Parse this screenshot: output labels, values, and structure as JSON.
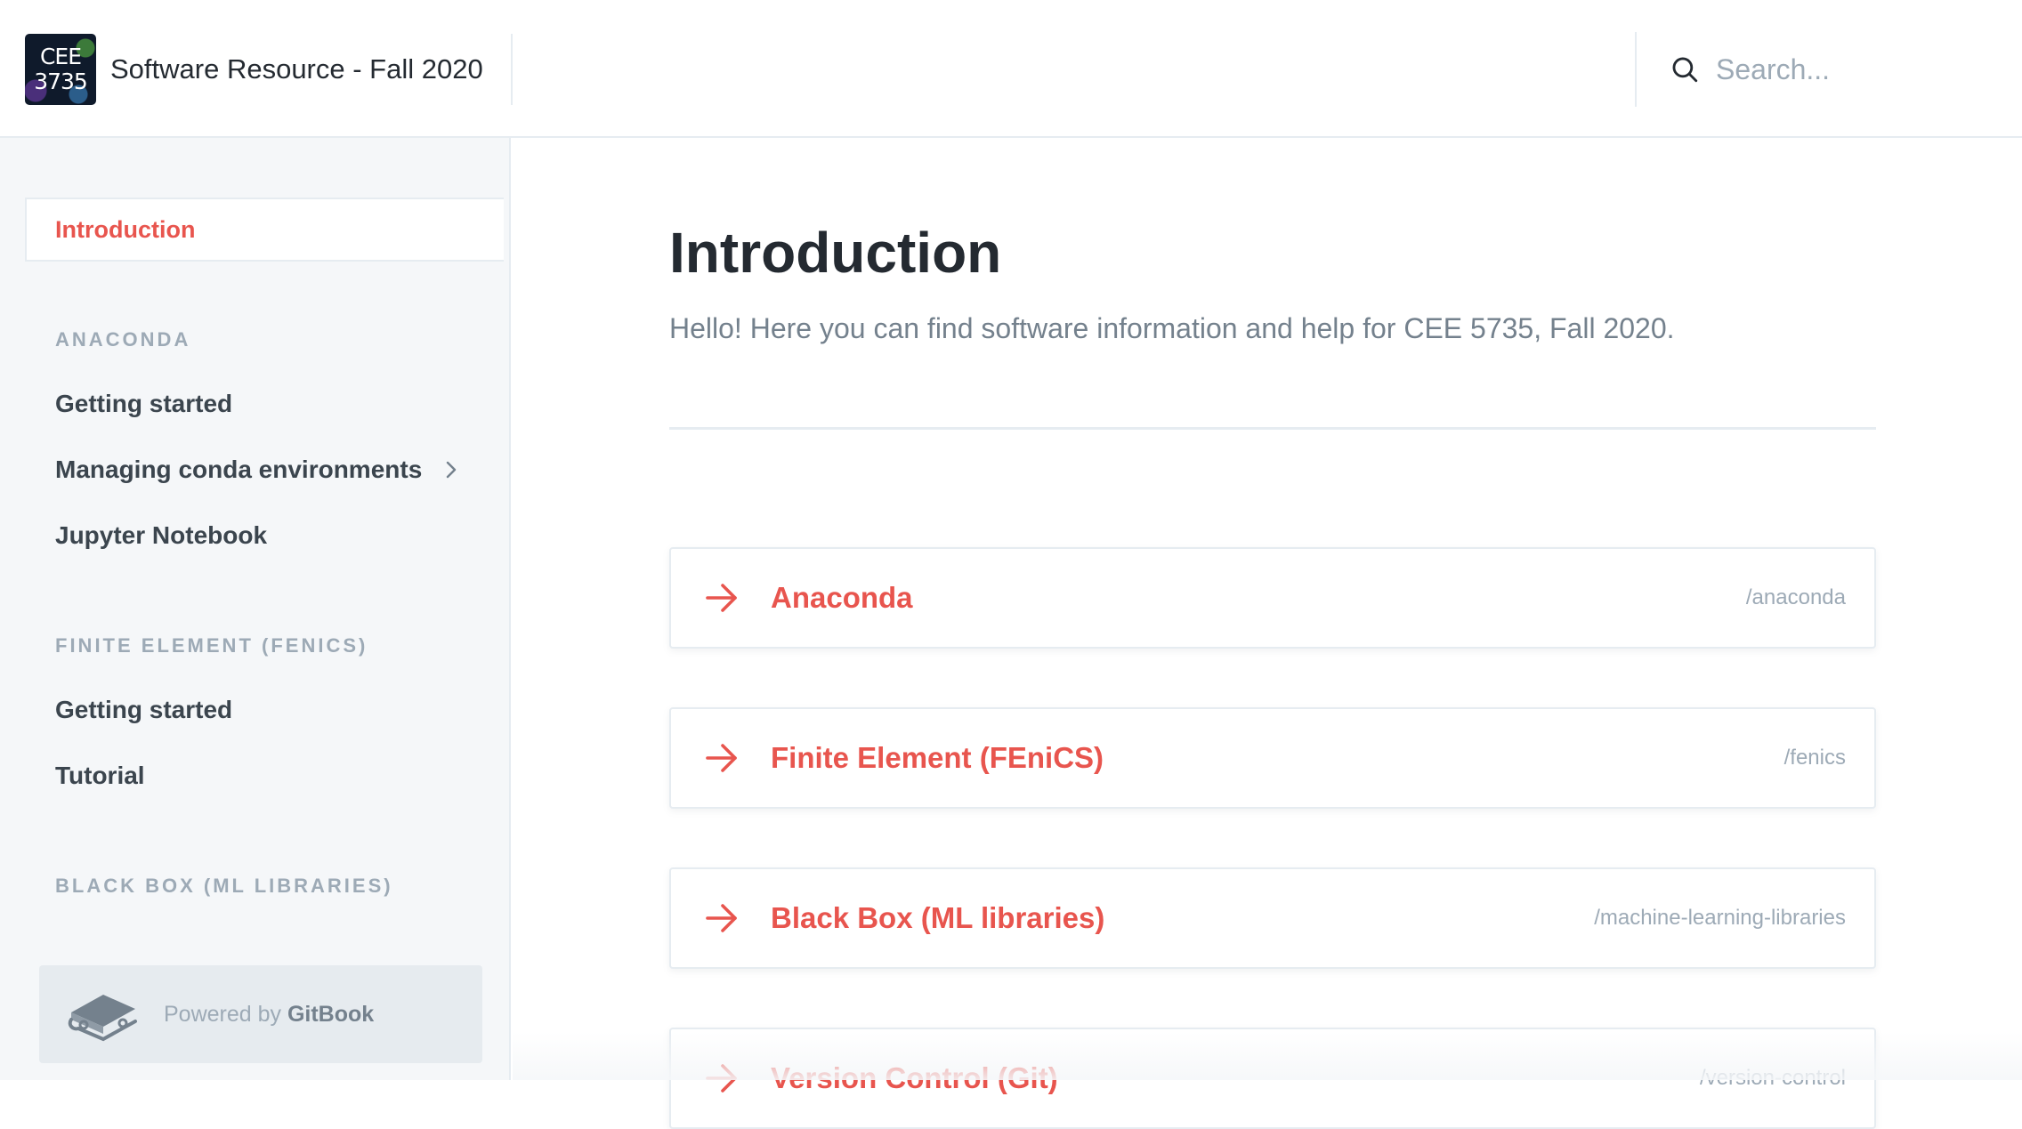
{
  "header": {
    "logo_line1": "CEE",
    "logo_line2": "3735",
    "title": "Software Resource - Fall 2020",
    "search_placeholder": "Search..."
  },
  "sidebar": {
    "active_item": "Introduction",
    "sections": [
      {
        "label": "ANACONDA",
        "items": [
          "Getting started",
          "Managing conda environments",
          "Jupyter Notebook"
        ]
      },
      {
        "label": "FINITE ELEMENT (FENICS)",
        "items": [
          "Getting started",
          "Tutorial"
        ]
      },
      {
        "label": "BLACK BOX (ML LIBRARIES)",
        "items": []
      }
    ],
    "powered_prefix": "Powered by ",
    "powered_brand": "GitBook"
  },
  "main": {
    "title": "Introduction",
    "description": "Hello! Here you can find software information and help for CEE 5735, Fall 2020.",
    "cards": [
      {
        "title": "Anaconda",
        "path": "/anaconda"
      },
      {
        "title": "Finite Element (FEniCS)",
        "path": "/fenics"
      },
      {
        "title": "Black Box (ML libraries)",
        "path": "/machine-learning-libraries"
      },
      {
        "title": "Version Control (Git)",
        "path": "/version-control"
      }
    ]
  },
  "colors": {
    "accent": "#e8554e",
    "sidebar_bg": "#f5f7f9",
    "border": "#e6ecf1",
    "muted_text": "#9daab6"
  }
}
